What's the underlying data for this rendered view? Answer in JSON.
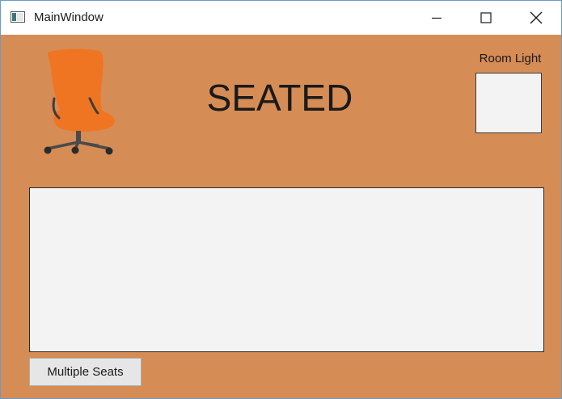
{
  "window": {
    "title": "MainWindow"
  },
  "header": {
    "status_text": "SEATED",
    "room_light_label": "Room Light",
    "chair_icon": "office-chair-icon"
  },
  "controls": {
    "multiple_seats_label": "Multiple Seats"
  },
  "colors": {
    "client_background": "#d68c55",
    "chair": "#f07522",
    "panel": "#f3f3f3"
  }
}
